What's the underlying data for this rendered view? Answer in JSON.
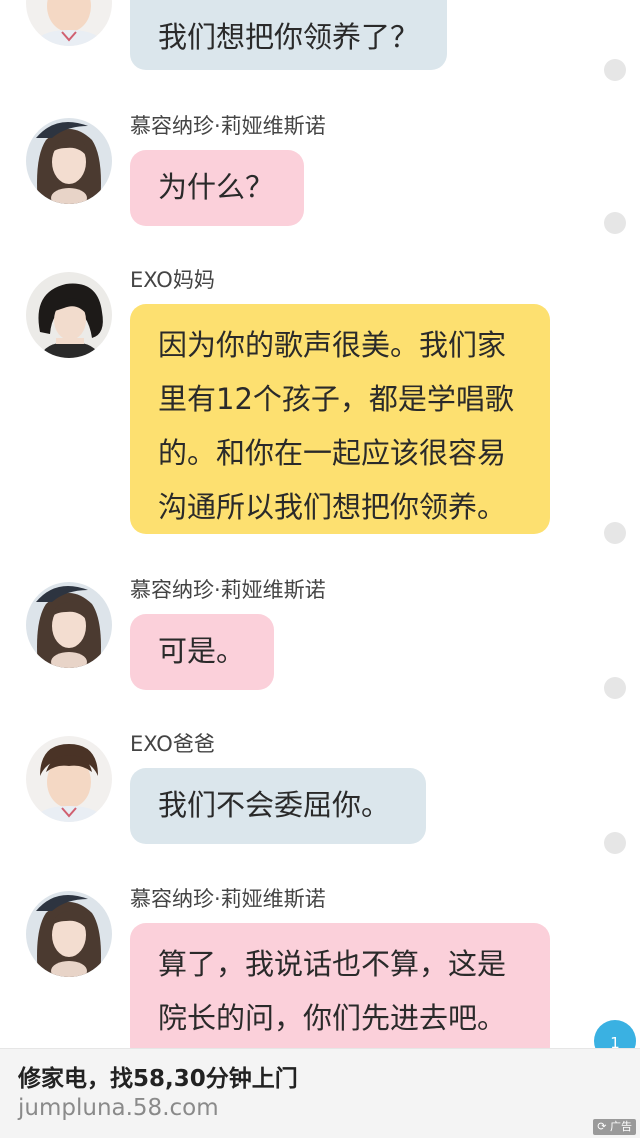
{
  "messages": [
    {
      "name": "",
      "text": "我们想把你领养了？",
      "avatar": "exo-dad-avatar"
    },
    {
      "name": "慕容纳珍·莉娅维斯诺",
      "text": "为什么？",
      "avatar": "long-hair-girl-avatar"
    },
    {
      "name": "EXO妈妈",
      "lines": [
        "因为你的歌声很美。我们家",
        "里有12个孩子，都是学唱歌",
        "的。和你在一起应该很容易",
        "沟通所以我们想把你领养。"
      ],
      "avatar": "short-hair-woman-avatar"
    },
    {
      "name": "慕容纳珍·莉娅维斯诺",
      "text": "可是。",
      "avatar": "long-hair-girl-avatar"
    },
    {
      "name": "EXO爸爸",
      "text": "我们不会委屈你。",
      "avatar": "exo-dad-avatar"
    },
    {
      "name": "慕容纳珍·莉娅维斯诺",
      "lines": [
        "算了，我说话也不算，这是",
        "院长的问，你们先进去吧。"
      ],
      "avatar": "long-hair-girl-avatar"
    }
  ],
  "colors": {
    "blue_bubble": "#dbe6ec",
    "pink_bubble": "#fbd0da",
    "yellow_bubble": "#fde070",
    "badge": "#3ab1e2"
  },
  "unread_badge": "1",
  "ad": {
    "title": "修家电，找58,30分钟上门",
    "url": "jumpluna.58.com",
    "tag": "广告"
  }
}
